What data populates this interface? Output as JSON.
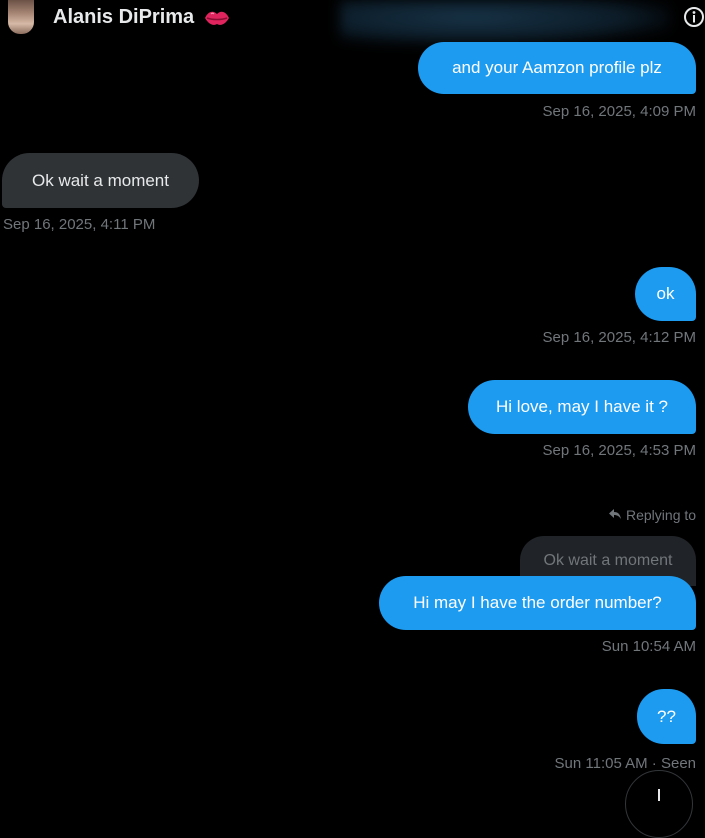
{
  "header": {
    "name": "Alanis DiPrima",
    "emoji_icon": "kiss-lips-icon",
    "info_icon": "info-icon"
  },
  "messages": [
    {
      "text": "and your Aamzon profile plz",
      "time": "Sep 16, 2025, 4:09 PM"
    },
    {
      "text": "Ok wait a moment",
      "time": "Sep 16, 2025, 4:11 PM"
    },
    {
      "text": "ok",
      "time": "Sep 16, 2025, 4:12 PM"
    },
    {
      "text": "Hi love, may I have it ?",
      "time": "Sep 16, 2025, 4:53 PM"
    },
    {
      "reply_label": "Replying to",
      "quoted": "Ok wait a moment",
      "text": "Hi may I have the order number?",
      "time": "Sun 10:54 AM"
    },
    {
      "text": "??",
      "time": "Sun 11:05 AM · Seen"
    }
  ],
  "colors": {
    "outgoing_bubble": "#1d9bf0",
    "incoming_bubble": "#2f3336",
    "timestamp": "#71767b",
    "background": "#000000"
  }
}
